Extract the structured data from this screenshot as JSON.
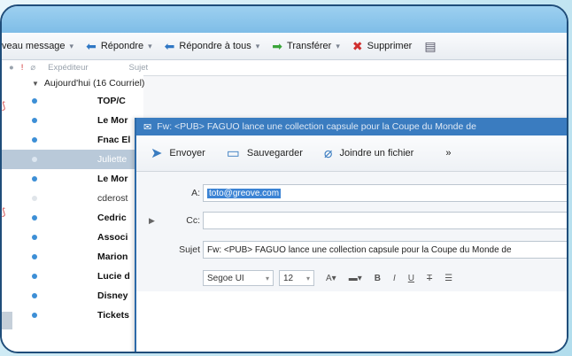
{
  "toolbar": {
    "new_message": "veau message",
    "reply": "Répondre",
    "reply_all": "Répondre à tous",
    "forward": "Transférer",
    "delete": "Supprimer"
  },
  "columns": {
    "sender": "Expéditeur",
    "subject": "Sujet"
  },
  "group_label": "Aujourd'hui (16 Courriel)",
  "messages": [
    {
      "sender": "TOP/C"
    },
    {
      "sender": "Le Mor"
    },
    {
      "sender": "Fnac El"
    },
    {
      "sender": "Juliette"
    },
    {
      "sender": "Le Mor"
    },
    {
      "sender": "cderost"
    },
    {
      "sender": "Cedric"
    },
    {
      "sender": "Associ"
    },
    {
      "sender": "Marion"
    },
    {
      "sender": "Lucie d"
    },
    {
      "sender": "Disney"
    },
    {
      "sender": "Tickets"
    }
  ],
  "compose": {
    "title": "Fw: <PUB> FAGUO lance une collection capsule pour la Coupe du Monde de",
    "send": "Envoyer",
    "save": "Sauvegarder",
    "attach": "Joindre un fichier",
    "more": "»",
    "to_label": "A:",
    "to_value": "toto@greove.com",
    "cc_label": "Cc:",
    "subject_label": "Sujet",
    "subject_value": "Fw: <PUB> FAGUO lance une collection capsule pour la Coupe du Monde de",
    "font": "Segoe UI",
    "size": "12"
  }
}
